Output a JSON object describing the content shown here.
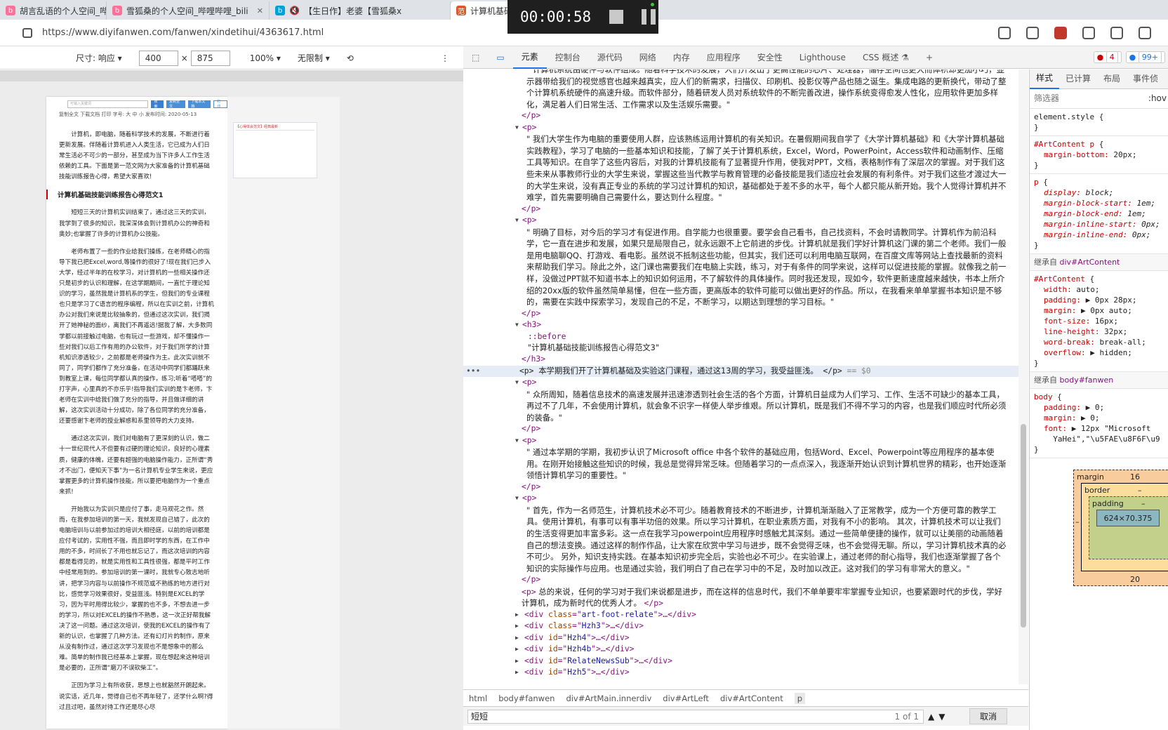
{
  "browser": {
    "tabs": [
      {
        "label": "胡言乱语的个人空间_哔",
        "icon": "bilibili-icon"
      },
      {
        "label": "雪狐桑的个人空间_哔哩哔哩_bili",
        "icon": "bilibili-icon"
      },
      {
        "label": "【生日作】老婆【雪狐桑x",
        "icon": "bilibili-icon"
      },
      {
        "label": "计算机基础技能训练报告心得",
        "icon": "fan-icon",
        "active": true
      }
    ],
    "url": "https://www.diyifanwen.com/fanwen/xindetihui/4363617.html"
  },
  "recorder": {
    "time": "00:00:58"
  },
  "device_toolbar": {
    "size_label": "尺寸: 响应",
    "width": "400",
    "times": "×",
    "height": "875",
    "zoom": "100%",
    "throttle": "无限制",
    "more": "⋮"
  },
  "page": {
    "search_placeholder": "可输入关键词",
    "btn_search": "搜索",
    "btn_copy": "复制全文",
    "btn_download": "下载本文档",
    "btn_print": "打印",
    "meta1": "复制全文   下载文档   打印   字号: 大 中 小   发布时间: 2020-05-13",
    "side_title": "【心得体会范文】经典最新",
    "intro": "计算机，即电脑，随着科学技术的发展，不断进行着更新发展。伴随着计算机进入人类生活，它已成为人们日常生活必不可少的一部分，甚至成为当下许多人工作生活依赖的工具。下面是第一范文网为大家准备的计算机基础技能训练报告心得，希望大家喜欢!",
    "h3": "计算机基础技能训练报告心得范文1",
    "p1": "短短三天的计算机实训结束了，通过这三天的实训，我学到了很多的知识，我深深体会到计算机办公的神奇和奥妙;也掌握了许多的计算机办公技能。",
    "p2": "老师布置了一些的作业给我们操练，在老师精心的指导下我已把Excel,word,等操作的很好了!现在我们已步入大学，经过半年的在校学习，对计算机的一些相关操作还只是初步的认识和理解，在这学期期间，一直忙于理论知识的学习，虽然我是计算机系的学生，但我们的专业课程也只是学习了C语言的程序编程，所以在实训之前，计算机办公对我们来说是比较抽象的，但通过这次实训，我们揭开了她神秘的面纱，离我们不再遥远!据我了解，大多数同学都以前接触过电脑，也有玩过一些游戏，却不懂操作一些对我们以后工作有用的办公软件，对于我们所学的计算机知识渗透较少，之前都是老师操作为主。此次实训就不同了，同学们都作了充分准备，在活动中同学们都踊跃来到教室上课，每位同学都认真的操作，练习;听着“嗒嗒”的打字声，心里真的不亦乐乎!指导我们实训的是卞老师，卞老师在实训中给我们做了充分的指导，并且做详细的讲解，这次实训活动十分成功，除了各位同学的充分准备，还要感谢卞老师的授业解惑和系里领导的大力支持。",
    "p3": "通过这次实训，我们对电脑有了更深刻的认识，做二十一世纪现代人不但要有过硬的理论知识，良好的心理素质，健康的体魄，还要有超强的电脑操作能力，正所谓“秀才不出门，便知天下事”为一名计算机专业学生来说，更应掌握更多的计算机操作技能，所以要把电脑作为一个重点来抓!",
    "p4": "开始我以为实训只是应付了事，走马观花之作。然而，在我参加培训的第一天，我就发现自己错了，此次的电脑培训与以前参加过的培训大相径庭，以前的培训都是应付考试的，实用性不强，而且即时学的东西，在工作中用的不多，时间长了不用也就忘记了，而这次培训的内容都是看得见的，就是实用性和工具性很强，都是平时工作中经常用到的。参加培训的第一课时，我就专心致志地听讲，把学习内容与以前操作不规范或不熟练的地方进行对比，感觉学习效果很好，受益匪浅。特别是EXCEL的学习，因为平时用得比较少，掌握的也不多，不想去进一步的学习，所以对EXCEL的操作不熟悉，这一次正好帮我解决了这一问题。通过这次培训，使我的EXCEL的操作有了新的认识，也掌握了几种方法。还有幻灯片的制作，原来从没有制作过，通过这次学习发现也不是想象中的那么难。简单的制作我已经基本上掌握，现在想起来这种培训是必要的，正所谓“磨刀不误砍柴工”。",
    "p5": "正因为学习上有所收获，思想上也就豁然开朗起来。说实话，近几年，觉得自己也不再年轻了，还学什么啊?得过且过吧，虽然对待工作还是尽心尽"
  },
  "devtools": {
    "tabs": [
      "元素",
      "控制台",
      "源代码",
      "网络",
      "内存",
      "应用程序",
      "安全性",
      "Lighthouse",
      "CSS 概述 ⚗",
      "+"
    ],
    "errors": "4",
    "warnings": "99+",
    "dom": {
      "t0": "\" 计算机系统由硬件与软件组成。随着科学技术的发展，人们开发出了更高性能的芯片、处理器，储存空间也更大而体积却更加小巧，显示器带给我们的视觉感官也越来越真实，应人们的新需求，扫描仪、印刷机、投影仪等产品也随之诞生。集成电路的更新换代，带动了整个计算机系统硬件的高速升级。而软件部分，随着研发人员对系统软件的不断完善改进，操作系统变得愈发人性化，应用软件更加多样化，满足着人们日常生活、工作需求以及生活娱乐需要。\"",
      "t1": "\" 我们大学生作为电脑的重要使用人群，应该熟练运用计算机的有关知识。在暑假期间我自学了《大学计算机基础》和《大学计算机基础实践教程》，学习了电脑的一些基本知识和技能，了解了关于计算机系统，Excel，Word，PowerPoint，Access软件和动画制作、压缩工具等知识。在自学了这些内容后，对我的计算机技能有了显著提升作用，使我对PPT，文档，表格制作有了深层次的掌握。对于我们这些未来从事教师行业的大学生来说，掌握这些当代教学与教育管理的必备技能是我们适应社会发展的有利条件。对于我们这些才渡过大一的大学生来说，没有真正专业的系统的学习过计算机的知识，基础都处于差不多的水平，每个人都只能从新开始。我个人觉得计算机并不难学，首先需要明确自己需要什么，要达到什么程度。\"",
      "t2": "\" 明确了目标，对今后的学习才有促进作用。自学能力也很重要。要学会自己看书，自己找资料，不会时请教同学。计算机作为前沿科学，它一直在进步和发展，如果只是局限自己，就永远跟不上它前进的步伐。计算机就是我们学好计算机这门课的第二个老师。我们一般是用电脑聊QQ、打游戏、看电影。虽然说不抵制这些功能，但其实，我们还可以利用电脑互联网，在百度文库等网站上查找最新的资料来帮助我们学习。除此之外，这门课也需要我们在电脑上实践，练习，对于有条件的同学来说，这样可以促进技能的掌握。就像我之前一样，没做过PPT就不知道书本上的知识如何运用，不了解软件的具体操作。同时我还发现，现如今，软件更新速度越来越快，书本上所介绍的20xx版的软件虽然简单易懂，但在一些方面，更高版本的软件可能可以做出更好的作品。所以，在我看来单单掌握书本知识是不够的，需要在实践中探索学习，发现自己的不足，不断学习，以期达到理想的学习目标。\"",
      "before": "::before",
      "h3text": "\"计算机基础技能训练报告心得范文3\"",
      "sel": "本学期我们开了计算机基础及实验这门课程，通过这13周的学习，我受益匪浅。",
      "sel_eq": "== $0",
      "t3": "\" 众所周知，随着信息技术的高速发展并迅速渗透到社会生活的各个方面，计算机日益成为人们学习、工作、生活不可缺少的基本工具，再过不了几年，不会使用计算机，就会象不识字一样使人举步维艰。所以计算机，既是我们不得不学习的内容，也是我们顺应时代所必须的装备。\"",
      "t4": "\" 通过本学期的学期，我初步认识了Microsoft office 中各个软件的基础应用，包括Word、Excel、Powerpoint等应用程序的基本使用。在刚开始接触这些知识的时候，我总是觉得异常乏味。但随着学习的一点点深入，我逐渐开始认识到计算机世界的精彩，也开始逐渐领悟计算机学习的重要性。\"",
      "t5": "\" 首先，作为一名师范生，计算机技术必不可少。随着教育技术的不断进步，计算机渐渐融入了正常教学，成为一个方便可靠的教学工具。使用计算机，有事可以有事半功倍的效果。所以学习计算机，在职业素质方面，对我有不小的影响。 其次，计算机技术可以让我们的生活变得更加丰富多彩。这一点在我学习powerpoint应用程序时感触尤其深刻。通过一些简单便捷的操作，就可以让美丽的动画随着自己的想法变换。通过这样的制作作品，让大家在欣赏中学习与进步，既不会觉得乏味，也不会觉得无聊。所以，学习计算机技术真的必不可少。 另外，知识支持实践。在基本知识初步完全后，实验也必不可少。在实验课上，通过老师的耐心指导，我们也逐渐掌握了各个知识的实际操作与应用。也是通过实验，我们明白了自己在学习中的不足，及时加以改正。这对我们的学习有非常大的意义。\"",
      "t6": "总的来说，任何的学习对于我们来说都是进步，而在这样的信息时代，我们不单单要牢牢掌握专业知识，也要紧跟时代的步伐，学好计算机，成为新时代的优秀人才。",
      "c1": "art-foot-relate",
      "c2": "Hzh3",
      "c3": "Hzh4",
      "c4": "Hzh4b",
      "c5": "RelateNewsSub",
      "c6": "Hzh5"
    },
    "breadcrumbs": [
      "html",
      "body#fanwen",
      "div#ArtMain.innerdiv",
      "div#ArtLeft",
      "div#ArtContent",
      "p"
    ],
    "find": {
      "value": "短短",
      "count": "1 of 1",
      "cancel": "取消"
    },
    "styles": {
      "tabs": [
        "样式",
        "已计算",
        "布局",
        "事件侦"
      ],
      "filter": "筛选器",
      "hov": ":hov",
      "inherit1": "继承自",
      "inherit1_sel": "div#ArtContent",
      "inherit2": "继承自",
      "inherit2_sel": "body#fanwen",
      "box": {
        "margin_label": "margin",
        "margin_top": "16",
        "margin_bottom": "20",
        "border_label": "border",
        "border_val": "–",
        "padding_label": "padding",
        "padding_val": "–",
        "content": "624×70.375",
        "side": "–"
      }
    }
  }
}
